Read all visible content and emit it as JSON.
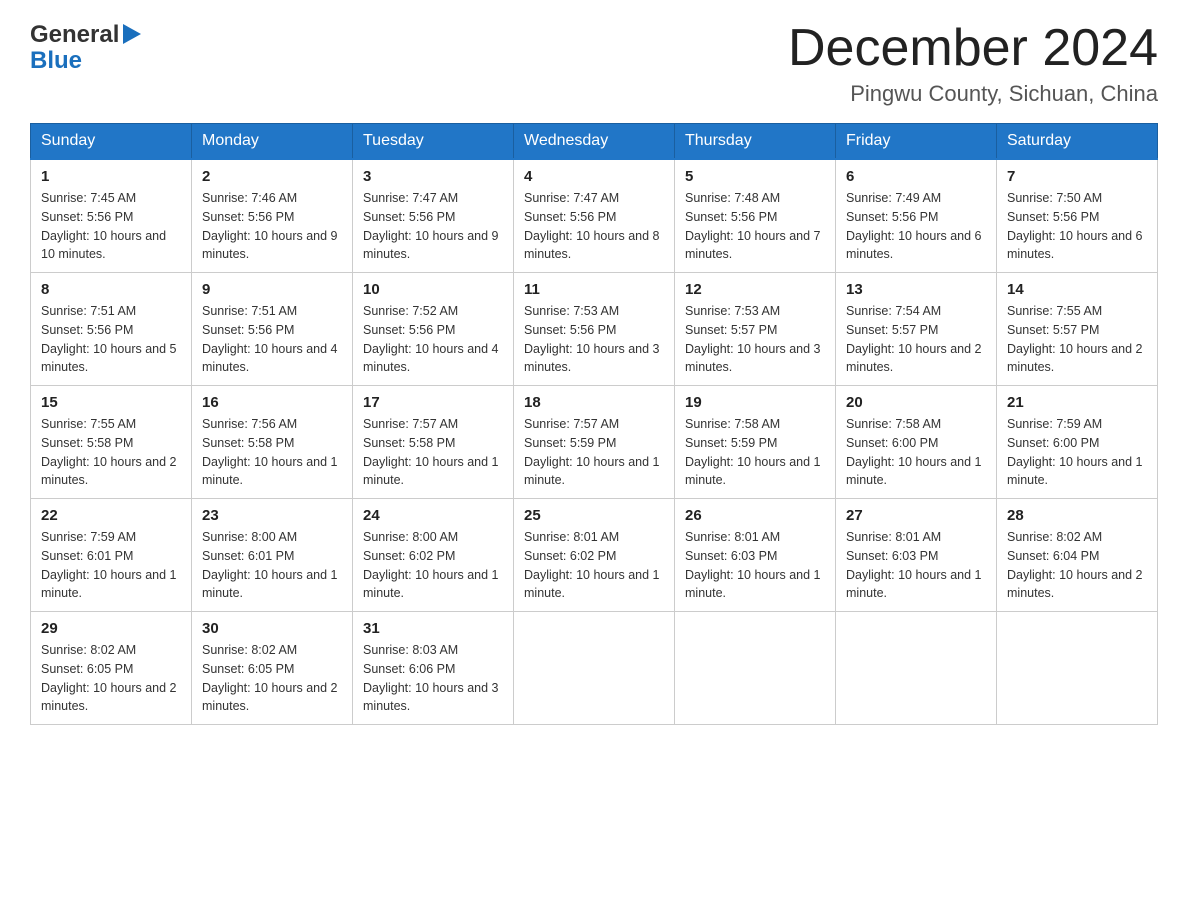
{
  "header": {
    "title": "December 2024",
    "subtitle": "Pingwu County, Sichuan, China",
    "logo_general": "General",
    "logo_blue": "Blue"
  },
  "days_of_week": [
    "Sunday",
    "Monday",
    "Tuesday",
    "Wednesday",
    "Thursday",
    "Friday",
    "Saturday"
  ],
  "weeks": [
    [
      {
        "day": "1",
        "sunrise": "7:45 AM",
        "sunset": "5:56 PM",
        "daylight": "10 hours and 10 minutes."
      },
      {
        "day": "2",
        "sunrise": "7:46 AM",
        "sunset": "5:56 PM",
        "daylight": "10 hours and 9 minutes."
      },
      {
        "day": "3",
        "sunrise": "7:47 AM",
        "sunset": "5:56 PM",
        "daylight": "10 hours and 9 minutes."
      },
      {
        "day": "4",
        "sunrise": "7:47 AM",
        "sunset": "5:56 PM",
        "daylight": "10 hours and 8 minutes."
      },
      {
        "day": "5",
        "sunrise": "7:48 AM",
        "sunset": "5:56 PM",
        "daylight": "10 hours and 7 minutes."
      },
      {
        "day": "6",
        "sunrise": "7:49 AM",
        "sunset": "5:56 PM",
        "daylight": "10 hours and 6 minutes."
      },
      {
        "day": "7",
        "sunrise": "7:50 AM",
        "sunset": "5:56 PM",
        "daylight": "10 hours and 6 minutes."
      }
    ],
    [
      {
        "day": "8",
        "sunrise": "7:51 AM",
        "sunset": "5:56 PM",
        "daylight": "10 hours and 5 minutes."
      },
      {
        "day": "9",
        "sunrise": "7:51 AM",
        "sunset": "5:56 PM",
        "daylight": "10 hours and 4 minutes."
      },
      {
        "day": "10",
        "sunrise": "7:52 AM",
        "sunset": "5:56 PM",
        "daylight": "10 hours and 4 minutes."
      },
      {
        "day": "11",
        "sunrise": "7:53 AM",
        "sunset": "5:56 PM",
        "daylight": "10 hours and 3 minutes."
      },
      {
        "day": "12",
        "sunrise": "7:53 AM",
        "sunset": "5:57 PM",
        "daylight": "10 hours and 3 minutes."
      },
      {
        "day": "13",
        "sunrise": "7:54 AM",
        "sunset": "5:57 PM",
        "daylight": "10 hours and 2 minutes."
      },
      {
        "day": "14",
        "sunrise": "7:55 AM",
        "sunset": "5:57 PM",
        "daylight": "10 hours and 2 minutes."
      }
    ],
    [
      {
        "day": "15",
        "sunrise": "7:55 AM",
        "sunset": "5:58 PM",
        "daylight": "10 hours and 2 minutes."
      },
      {
        "day": "16",
        "sunrise": "7:56 AM",
        "sunset": "5:58 PM",
        "daylight": "10 hours and 1 minute."
      },
      {
        "day": "17",
        "sunrise": "7:57 AM",
        "sunset": "5:58 PM",
        "daylight": "10 hours and 1 minute."
      },
      {
        "day": "18",
        "sunrise": "7:57 AM",
        "sunset": "5:59 PM",
        "daylight": "10 hours and 1 minute."
      },
      {
        "day": "19",
        "sunrise": "7:58 AM",
        "sunset": "5:59 PM",
        "daylight": "10 hours and 1 minute."
      },
      {
        "day": "20",
        "sunrise": "7:58 AM",
        "sunset": "6:00 PM",
        "daylight": "10 hours and 1 minute."
      },
      {
        "day": "21",
        "sunrise": "7:59 AM",
        "sunset": "6:00 PM",
        "daylight": "10 hours and 1 minute."
      }
    ],
    [
      {
        "day": "22",
        "sunrise": "7:59 AM",
        "sunset": "6:01 PM",
        "daylight": "10 hours and 1 minute."
      },
      {
        "day": "23",
        "sunrise": "8:00 AM",
        "sunset": "6:01 PM",
        "daylight": "10 hours and 1 minute."
      },
      {
        "day": "24",
        "sunrise": "8:00 AM",
        "sunset": "6:02 PM",
        "daylight": "10 hours and 1 minute."
      },
      {
        "day": "25",
        "sunrise": "8:01 AM",
        "sunset": "6:02 PM",
        "daylight": "10 hours and 1 minute."
      },
      {
        "day": "26",
        "sunrise": "8:01 AM",
        "sunset": "6:03 PM",
        "daylight": "10 hours and 1 minute."
      },
      {
        "day": "27",
        "sunrise": "8:01 AM",
        "sunset": "6:03 PM",
        "daylight": "10 hours and 1 minute."
      },
      {
        "day": "28",
        "sunrise": "8:02 AM",
        "sunset": "6:04 PM",
        "daylight": "10 hours and 2 minutes."
      }
    ],
    [
      {
        "day": "29",
        "sunrise": "8:02 AM",
        "sunset": "6:05 PM",
        "daylight": "10 hours and 2 minutes."
      },
      {
        "day": "30",
        "sunrise": "8:02 AM",
        "sunset": "6:05 PM",
        "daylight": "10 hours and 2 minutes."
      },
      {
        "day": "31",
        "sunrise": "8:03 AM",
        "sunset": "6:06 PM",
        "daylight": "10 hours and 3 minutes."
      },
      {
        "day": "",
        "sunrise": "",
        "sunset": "",
        "daylight": ""
      },
      {
        "day": "",
        "sunrise": "",
        "sunset": "",
        "daylight": ""
      },
      {
        "day": "",
        "sunrise": "",
        "sunset": "",
        "daylight": ""
      },
      {
        "day": "",
        "sunrise": "",
        "sunset": "",
        "daylight": ""
      }
    ]
  ]
}
